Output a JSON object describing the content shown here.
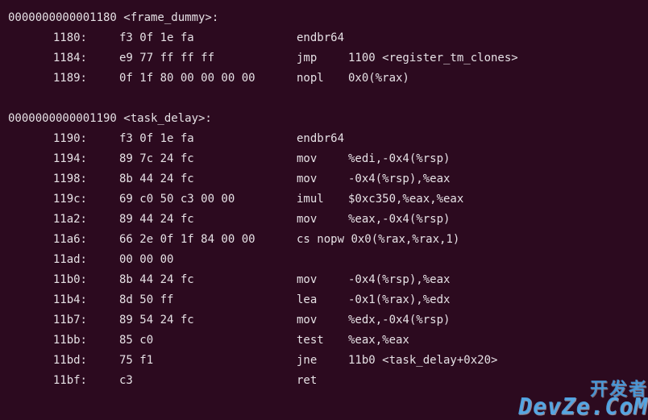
{
  "sections": [
    {
      "header": "0000000000001180 <frame_dummy>:",
      "rows": [
        {
          "addr": "1180:",
          "hex": "f3 0f 1e fa",
          "mnem": "endbr64",
          "op": ""
        },
        {
          "addr": "1184:",
          "hex": "e9 77 ff ff ff",
          "mnem": "jmp",
          "op": "1100 <register_tm_clones>"
        },
        {
          "addr": "1189:",
          "hex": "0f 1f 80 00 00 00 00",
          "mnem": "nopl",
          "op": "0x0(%rax)"
        }
      ]
    },
    {
      "header": "0000000000001190 <task_delay>:",
      "rows": [
        {
          "addr": "1190:",
          "hex": "f3 0f 1e fa",
          "mnem": "endbr64",
          "op": ""
        },
        {
          "addr": "1194:",
          "hex": "89 7c 24 fc",
          "mnem": "mov",
          "op": "%edi,-0x4(%rsp)"
        },
        {
          "addr": "1198:",
          "hex": "8b 44 24 fc",
          "mnem": "mov",
          "op": "-0x4(%rsp),%eax"
        },
        {
          "addr": "119c:",
          "hex": "69 c0 50 c3 00 00",
          "mnem": "imul",
          "op": "$0xc350,%eax,%eax"
        },
        {
          "addr": "11a2:",
          "hex": "89 44 24 fc",
          "mnem": "mov",
          "op": "%eax,-0x4(%rsp)"
        },
        {
          "addr": "11a6:",
          "hex": "66 2e 0f 1f 84 00 00",
          "mnem": "cs nopw",
          "op": "0x0(%rax,%rax,1)",
          "wide": true
        },
        {
          "addr": "11ad:",
          "hex": "00 00 00",
          "mnem": "",
          "op": ""
        },
        {
          "addr": "11b0:",
          "hex": "8b 44 24 fc",
          "mnem": "mov",
          "op": "-0x4(%rsp),%eax"
        },
        {
          "addr": "11b4:",
          "hex": "8d 50 ff",
          "mnem": "lea",
          "op": "-0x1(%rax),%edx"
        },
        {
          "addr": "11b7:",
          "hex": "89 54 24 fc",
          "mnem": "mov",
          "op": "%edx,-0x4(%rsp)"
        },
        {
          "addr": "11bb:",
          "hex": "85 c0",
          "mnem": "test",
          "op": "%eax,%eax"
        },
        {
          "addr": "11bd:",
          "hex": "75 f1",
          "mnem": "jne",
          "op": "11b0 <task_delay+0x20>"
        },
        {
          "addr": "11bf:",
          "hex": "c3",
          "mnem": "ret",
          "op": ""
        }
      ]
    }
  ],
  "watermark": {
    "line1": "开发者",
    "line2": "DevZe.CoM"
  }
}
